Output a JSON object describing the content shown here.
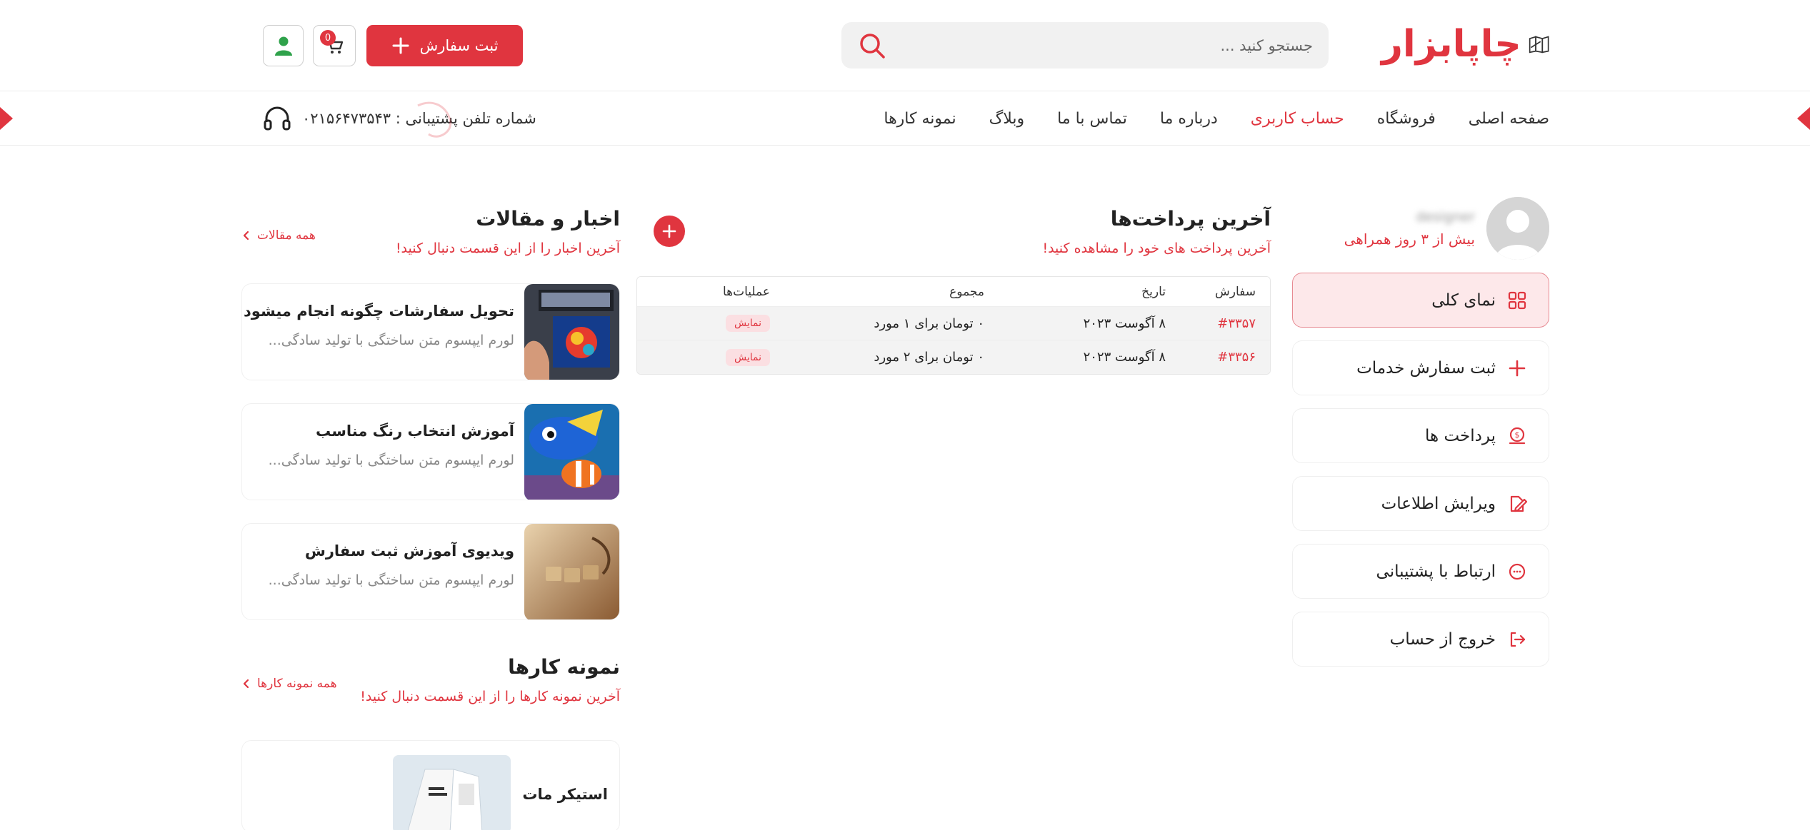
{
  "brand": {
    "logo_text": "چاپابزار",
    "accent": "#e0353f"
  },
  "search": {
    "placeholder": "جستجو کنید ..."
  },
  "header": {
    "order_label": "ثبت سفارش",
    "cart_count": "0"
  },
  "nav": {
    "items": [
      {
        "label": "صفحه اصلی",
        "active": false
      },
      {
        "label": "فروشگاه",
        "active": false
      },
      {
        "label": "حساب کاربری",
        "active": true
      },
      {
        "label": "درباره ما",
        "active": false
      },
      {
        "label": "تماس با ما",
        "active": false
      },
      {
        "label": "وبلاگ",
        "active": false
      },
      {
        "label": "نمونه کارها",
        "active": false
      }
    ],
    "support": "شماره تلفن پشتیبانی : ۰۲۱۵۶۴۷۳۵۴۳"
  },
  "profile": {
    "name": "designer",
    "subtitle": "بیش از ۳ روز همراهی"
  },
  "menu": [
    {
      "label": "نمای کلی",
      "icon": "grid-icon",
      "active": true
    },
    {
      "label": "ثبت سفارش خدمات",
      "icon": "plus-icon",
      "active": false
    },
    {
      "label": "پرداخت ها",
      "icon": "coin-icon",
      "active": false
    },
    {
      "label": "ویرایش اطلاعات",
      "icon": "edit-icon",
      "active": false
    },
    {
      "label": "ارتباط با پشتیبانی",
      "icon": "chat-icon",
      "active": false
    },
    {
      "label": "خروج از حساب",
      "icon": "logout-icon",
      "active": false
    }
  ],
  "payments": {
    "title": "آخرین پرداخت‌ها",
    "subtitle": "آخرین پرداخت های خود را مشاهده کنید!",
    "columns": [
      "سفارش",
      "تاریخ",
      "مجموع",
      "عملیات‌ها"
    ],
    "rows": [
      {
        "order": "#۳۳۵۷",
        "date": "۸ آگوست ۲۰۲۳",
        "total": "۰ تومان برای ۱ مورد",
        "action": "نمایش"
      },
      {
        "order": "#۳۳۵۶",
        "date": "۸ آگوست ۲۰۲۳",
        "total": "۰ تومان برای ۲ مورد",
        "action": "نمایش"
      }
    ]
  },
  "news": {
    "title": "اخبار و مقالات",
    "subtitle": "آخرین اخبار را از این قسمت دنبال کنید!",
    "all_link": "همه مقالات",
    "items": [
      {
        "title": "تحویل سفارشات چگونه انجام میشود",
        "desc": "لورم ایپسوم متن ساختگی با تولید سادگی..."
      },
      {
        "title": "آموزش انتخاب رنگ مناسب",
        "desc": "لورم ایپسوم متن ساختگی با تولید سادگی..."
      },
      {
        "title": "ویدیوی آموزش ثبت سفارش",
        "desc": "لورم ایپسوم متن ساختگی با تولید سادگی..."
      }
    ]
  },
  "works": {
    "title": "نمونه کارها",
    "subtitle": "آخرین نمونه کارها را از این قسمت دنبال کنید!",
    "all_link": "همه نمونه کارها",
    "items": [
      {
        "title": "استیکر مات"
      }
    ]
  }
}
